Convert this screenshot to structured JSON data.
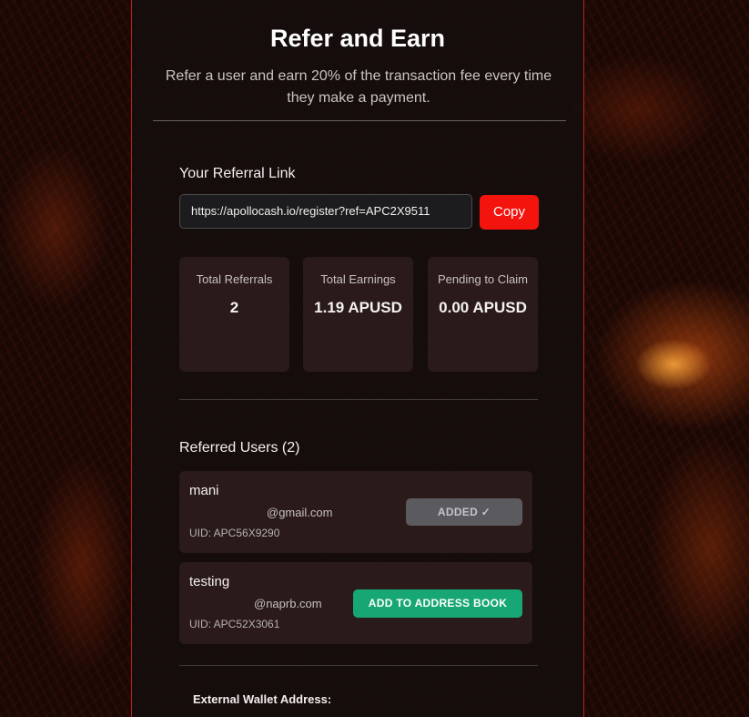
{
  "header": {
    "title": "Refer and Earn",
    "subtitle": "Refer a user and earn 20% of the transaction fee every time they make a payment."
  },
  "referral": {
    "label": "Your Referral Link",
    "link": "https://apollocash.io/register?ref=APC2X9511",
    "copy_label": "Copy"
  },
  "stats": [
    {
      "label": "Total Referrals",
      "value": "2"
    },
    {
      "label": "Total Earnings",
      "value": "1.19 APUSD"
    },
    {
      "label": "Pending to Claim",
      "value": "0.00 APUSD"
    }
  ],
  "referred_users": {
    "heading": "Referred Users (2)",
    "items": [
      {
        "name": "mani",
        "email": "@gmail.com",
        "uid": "UID: APC56X9290",
        "action": "ADDED ✓"
      },
      {
        "name": "testing",
        "email": "@naprb.com",
        "uid": "UID: APC52X3061",
        "action": "ADD TO ADDRESS BOOK"
      }
    ]
  },
  "wallet": {
    "label": "External Wallet Address:"
  },
  "colors": {
    "accent_red": "#f3140e",
    "border_red": "#b3261e",
    "success_green": "#17a774",
    "disabled_gray": "#5b5a5e"
  }
}
